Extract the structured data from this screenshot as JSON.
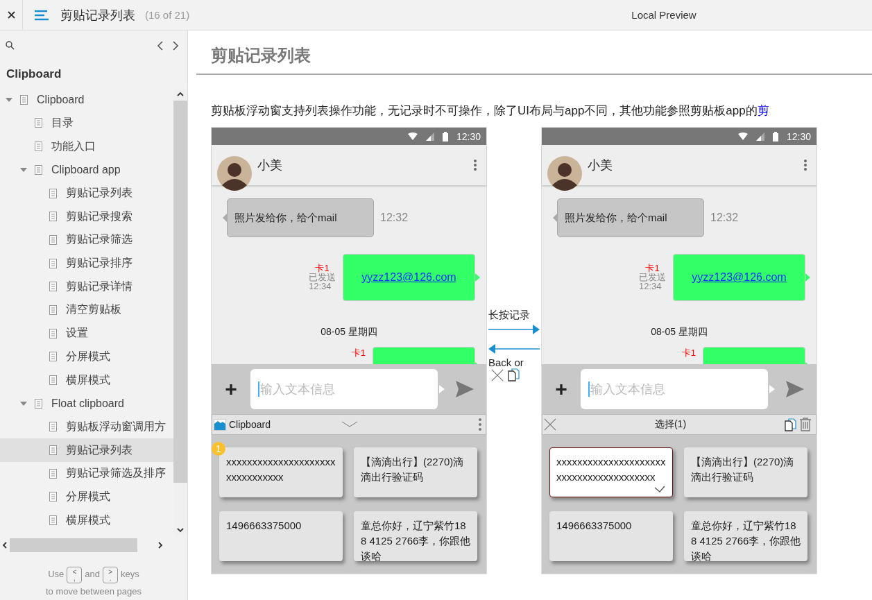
{
  "topbar": {
    "title": "剪贴记录列表",
    "counter": "(16 of 21)",
    "preview_label": "Local Preview"
  },
  "sidebar": {
    "heading": "Clipboard",
    "tree": [
      {
        "label": "Clipboard",
        "selected": false,
        "expanded": true,
        "children": [
          {
            "label": "目录",
            "selected": false
          },
          {
            "label": "功能入口",
            "selected": false
          },
          {
            "label": "Clipboard app",
            "selected": false,
            "expanded": true,
            "children": [
              {
                "label": "剪贴记录列表",
                "selected": false
              },
              {
                "label": "剪贴记录搜索",
                "selected": false
              },
              {
                "label": "剪贴记录筛选",
                "selected": false
              },
              {
                "label": "剪贴记录排序",
                "selected": false
              },
              {
                "label": "剪贴记录详情",
                "selected": false
              },
              {
                "label": "清空剪贴板",
                "selected": false
              },
              {
                "label": "设置",
                "selected": false
              },
              {
                "label": "分屏模式",
                "selected": false
              },
              {
                "label": "横屏模式",
                "selected": false
              }
            ]
          },
          {
            "label": "Float clipboard",
            "selected": false,
            "expanded": true,
            "children": [
              {
                "label": "剪贴板浮动窗调用方",
                "selected": false
              },
              {
                "label": "剪贴记录列表",
                "selected": true
              },
              {
                "label": "剪贴记录筛选及排序",
                "selected": false
              },
              {
                "label": "分屏模式",
                "selected": false
              },
              {
                "label": "横屏模式",
                "selected": false
              }
            ]
          }
        ]
      }
    ],
    "footer": {
      "prefix": "Use",
      "key_prev": {
        "top": "<",
        "bottom": ","
      },
      "middle": "and",
      "key_next": {
        "top": ">",
        "bottom": "."
      },
      "suffix": "keys",
      "line2": "to move between pages"
    }
  },
  "page_title": "剪贴记录列表",
  "intro": {
    "text": "剪贴板浮动窗支持列表操作功能，无记录时不可操作，除了UI布局与app不同，其他功能参照剪贴板app的",
    "link": "剪"
  },
  "phones": [
    {
      "status_time": "12:30",
      "contact": "小美",
      "messages": [
        {
          "kind": "received",
          "text": "照片发给你，给个mail",
          "time": "12:32"
        },
        {
          "kind": "sent",
          "sim": "卡1",
          "status": "已发送",
          "time": "12:34",
          "text": "yyzz123@126.com"
        },
        {
          "kind": "date",
          "text": "08-05  星期四"
        },
        {
          "kind": "sent",
          "sim": "卡1"
        }
      ],
      "add_label": "+",
      "input_placeholder": "输入文本信息",
      "panel": {
        "kind": "clipboard",
        "title": "Clipboard"
      },
      "cards": [
        {
          "text": "xxxxxxxxxxxxxxxxxxxxxxxxxxxxxxxx",
          "selected": false,
          "badge": "1"
        },
        {
          "text": "【滴滴出行】(2270)滴滴出行验证码",
          "selected": false
        },
        {
          "text": "1496663375000",
          "selected": false
        },
        {
          "text": "童总你好，辽宁紫竹188 4125 2766李，你跟他谈哈",
          "selected": false
        }
      ]
    },
    {
      "status_time": "12:30",
      "contact": "小美",
      "messages": [
        {
          "kind": "received",
          "text": "照片发给你，给个mail",
          "time": "12:32"
        },
        {
          "kind": "sent",
          "sim": "卡1",
          "status": "已发送",
          "time": "12:34",
          "text": "yyzz123@126.com"
        },
        {
          "kind": "date",
          "text": "08-05  星期四"
        },
        {
          "kind": "sent",
          "sim": "卡1"
        }
      ],
      "add_label": "+",
      "input_placeholder": "输入文本信息",
      "panel": {
        "kind": "selection",
        "title": "选择(1)"
      },
      "cards": [
        {
          "text": "xxxxxxxxxxxxxxxxxxxxxxxxxxxxxxxxxxxxxxxx",
          "selected": true
        },
        {
          "text": "【滴滴出行】(2270)滴滴出行验证码",
          "selected": false
        },
        {
          "text": "1496663375000",
          "selected": false
        },
        {
          "text": "童总你好，辽宁紫竹188 4125 2766李，你跟他谈哈",
          "selected": false
        }
      ]
    }
  ],
  "transition": {
    "forward_label": "长按记录",
    "back_label": "Back or"
  }
}
